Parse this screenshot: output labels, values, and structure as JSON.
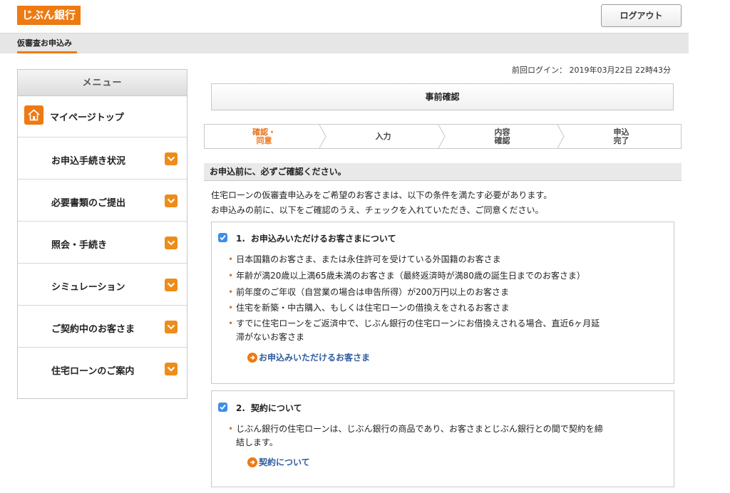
{
  "header": {
    "logo_text": "じぶん銀行",
    "logout_label": "ログアウト",
    "breadcrumb": "仮審査お申込み",
    "colors": {
      "brand": "#ee7a12",
      "link": "#2f5c9e",
      "checkbox": "#3d8ee8"
    }
  },
  "sidebar": {
    "menu_title": "メニュー",
    "mypage_label": "マイページトップ",
    "items": [
      {
        "label": "お申込手続き状況"
      },
      {
        "label": "必要書類のご提出"
      },
      {
        "label": "照会・手続き"
      },
      {
        "label": "シミュレーション"
      },
      {
        "label": "ご契約中のお客さま"
      },
      {
        "label": "住宅ローンのご案内"
      }
    ]
  },
  "main": {
    "last_login": "前回ログイン： 2019年03月22日 22時43分",
    "page_title": "事前確認",
    "steps": [
      {
        "line1": "確認・",
        "line2": "同意",
        "active": true
      },
      {
        "line1": "入力",
        "line2": "",
        "active": false
      },
      {
        "line1": "内容",
        "line2": "確認",
        "active": false
      },
      {
        "line1": "申込",
        "line2": "完了",
        "active": false
      }
    ],
    "section_heading": "お申込前に、必ずご確認ください。",
    "intro_line1": "住宅ローンの仮審査申込みをご希望のお客さまは、以下の条件を満たす必要があります。",
    "intro_line2": "お申込みの前に、以下をご確認のうえ、チェックを入れていただき、ご同意ください。",
    "card1": {
      "number": "1.",
      "title": "お申込みいただけるお客さまについて",
      "checked": true,
      "bullets": [
        "日本国籍のお客さま、または永住許可を受けている外国籍のお客さま",
        "年齢が満20歳以上満65歳未満のお客さま（最終返済時が満80歳の誕生日までのお客さま）",
        "前年度のご年収（自営業の場合は申告所得）が200万円以上のお客さま",
        "住宅を新築・中古購入、もしくは住宅ローンの借換えをされるお客さま",
        "すでに住宅ローンをご返済中で、じぶん銀行の住宅ローンにお借換えされる場合、直近6ヶ月延",
        "滞がないお客さま"
      ],
      "link": "お申込みいただけるお客さま"
    },
    "card2": {
      "number": "2.",
      "title": "契約について",
      "checked": true,
      "bullets": [
        "じぶん銀行の住宅ローンは、じぶん銀行の商品であり、お客さまとじぶん銀行との間で契約を締",
        "結します。"
      ],
      "link": "契約について"
    }
  }
}
